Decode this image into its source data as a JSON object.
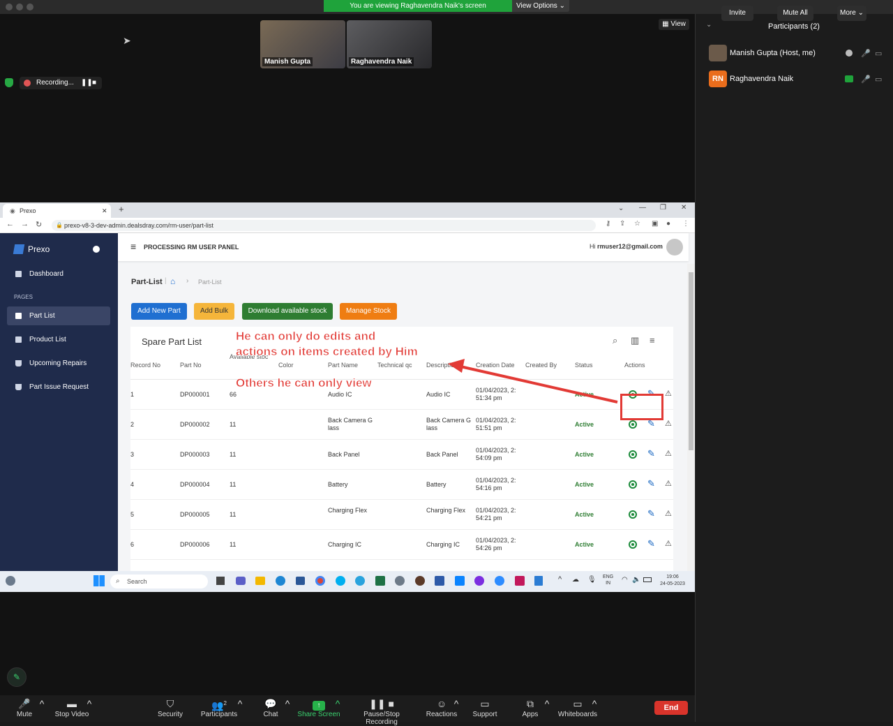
{
  "zoom": {
    "banner": "You are viewing Raghavendra Naik's screen",
    "view_options": "View Options",
    "view_button": "View",
    "recording": "Recording...",
    "thumbnails": [
      {
        "name": "Manish Gupta"
      },
      {
        "name": "Raghavendra Naik"
      }
    ]
  },
  "participants": {
    "title": "Participants (2)",
    "items": [
      {
        "name": "Manish Gupta (Host, me)",
        "initials": ""
      },
      {
        "name": "Raghavendra Naik",
        "initials": "RN"
      }
    ],
    "invite": "Invite",
    "mute_all": "Mute All",
    "more": "More"
  },
  "browser": {
    "tab_title": "Prexo",
    "url": "prexo-v8-3-dev-admin.dealsdray.com/rm-user/part-list"
  },
  "app": {
    "brand": "Prexo",
    "panel_title": "PROCESSING RM USER PANEL",
    "greeting": "Hi",
    "user_email": "rmuser12@gmail.com",
    "sidebar": {
      "dashboard": "Dashboard",
      "section_label": "PAGES",
      "items": [
        {
          "label": "Part List"
        },
        {
          "label": "Product List"
        },
        {
          "label": "Upcoming Repairs"
        },
        {
          "label": "Part Issue Request"
        }
      ]
    },
    "breadcrumb": {
      "current": "Part-List",
      "trail": "Part-List"
    },
    "buttons": {
      "add_new_part": "Add New Part",
      "add_bulk": "Add Bulk",
      "download_stock": "Download available stock",
      "manage_stock": "Manage Stock"
    },
    "table": {
      "title": "Spare Part List",
      "columns": [
        "Record No",
        "Part No",
        "Available stoc",
        "Color",
        "Part Name",
        "Technical qc",
        "Description",
        "Creation Date",
        "Created By",
        "Status",
        "Actions"
      ],
      "rows": [
        {
          "record": "1",
          "part_no": "DP000001",
          "stock": "66",
          "part_name": "Audio IC",
          "description": "Audio IC",
          "date1": "01/04/2023, 2:",
          "date2": "51:34 pm",
          "status": "Active"
        },
        {
          "record": "2",
          "part_no": "DP000002",
          "stock": "11",
          "part_name": "Back Camera G lass",
          "description": "Back Camera G lass",
          "date1": "01/04/2023, 2:",
          "date2": "51:51 pm",
          "status": "Active"
        },
        {
          "record": "3",
          "part_no": "DP000003",
          "stock": "11",
          "part_name": "Back Panel",
          "description": "Back Panel",
          "date1": "01/04/2023, 2:",
          "date2": "54:09 pm",
          "status": "Active"
        },
        {
          "record": "4",
          "part_no": "DP000004",
          "stock": "11",
          "part_name": "Battery",
          "description": "Battery",
          "date1": "01/04/2023, 2:",
          "date2": "54:16 pm",
          "status": "Active"
        },
        {
          "record": "5",
          "part_no": "DP000005",
          "stock": "11",
          "part_name": "Charging Flex",
          "description": "Charging Flex",
          "date1": "01/04/2023, 2:",
          "date2": "54:21 pm",
          "status": "Active"
        },
        {
          "record": "6",
          "part_no": "DP000006",
          "stock": "11",
          "part_name": "Charging IC",
          "description": "Charging IC",
          "date1": "01/04/2023, 2:",
          "date2": "54:26 pm",
          "status": "Active"
        }
      ]
    }
  },
  "annotation": {
    "line1": "He can only do edits and",
    "line2": "actions on items created by Him",
    "line3": "Others he can only view"
  },
  "taskbar": {
    "search": "Search",
    "lang1": "ENG",
    "lang2": "IN",
    "time": "19:06",
    "date": "24-05-2023"
  },
  "toolbar": {
    "mute": "Mute",
    "stop_video": "Stop Video",
    "security": "Security",
    "participants": "Participants",
    "participants_count": "2",
    "chat": "Chat",
    "share_screen": "Share Screen",
    "pause_stop": "Pause/Stop Recording",
    "reactions": "Reactions",
    "support": "Support",
    "apps": "Apps",
    "whiteboards": "Whiteboards",
    "end": "End"
  },
  "colors": {
    "sidebar_bg": "#1f2b4b",
    "add_new_part": "#1f6fd1",
    "add_bulk": "#f5b53a",
    "download": "#2e7d32",
    "manage": "#ef7d12",
    "status_active": "#2e7d32",
    "annotation": "#e23a35",
    "end": "#d9342b"
  }
}
